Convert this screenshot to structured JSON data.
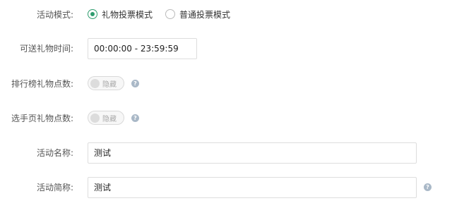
{
  "activity_mode": {
    "label": "活动模式:",
    "options": [
      {
        "label": "礼物投票模式",
        "checked": true
      },
      {
        "label": "普通投票模式",
        "checked": false
      }
    ],
    "accent_color": "#2e9c6e"
  },
  "gift_time": {
    "label": "可送礼物时间:",
    "value": "00:00:00 - 23:59:59"
  },
  "ranking_points": {
    "label": "排行榜礼物点数:",
    "toggle_text": "隐藏",
    "help_icon": "question-circle-icon"
  },
  "contestant_points": {
    "label": "选手页礼物点数:",
    "toggle_text": "隐藏",
    "help_icon": "question-circle-icon"
  },
  "activity_name": {
    "label": "活动名称:",
    "value": "测试"
  },
  "activity_short_name": {
    "label": "活动简称:",
    "value": "测试",
    "help_icon": "question-circle-icon"
  }
}
